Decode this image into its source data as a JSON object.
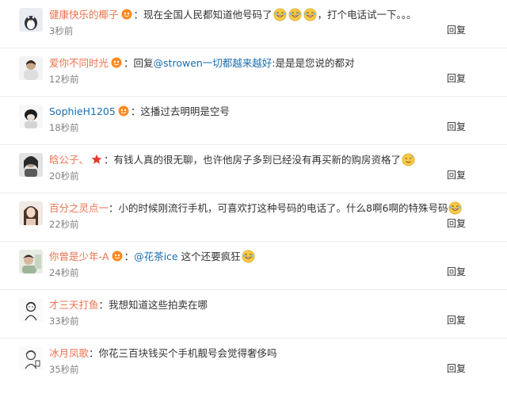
{
  "comments": [
    {
      "username": "健康快乐的椰子",
      "colon": "：",
      "text_before": "现在全国人民都知道他号码了",
      "emoji_count": 3,
      "text_after": "，打个电话试一下。。。",
      "time": "3秒前",
      "reply": "回复"
    },
    {
      "username": "爱你不同时光",
      "colon": "：",
      "reply_prefix": "回复",
      "mention": "@strowen一切都越来越好",
      "text_after": ":是是是您说的都对",
      "time": "12秒前",
      "reply": "回复"
    },
    {
      "username": "SophieH1205",
      "colon": "：",
      "text": "这播过去明明是空号",
      "time": "18秒前",
      "reply": "回复"
    },
    {
      "username": "晗公子、",
      "colon": "：",
      "text": "有钱人真的很无聊，也许他房子多到已经没有再买新的购房资格了",
      "time": "20秒前",
      "reply": "回复"
    },
    {
      "username": "百分之灵点一",
      "colon": "：",
      "text": "小的时候刚流行手机，可喜欢打这种号码的电话了。什么8啊6啊的特殊号码",
      "time": "22秒前",
      "reply": "回复"
    },
    {
      "username": "你曾是少年-A",
      "colon": "：",
      "mention": "@花茶ice",
      "text": "这个还要疯狂",
      "time": "24秒前",
      "reply": "回复"
    },
    {
      "username": "才三天打鱼",
      "colon": "：",
      "text": "我想知道这些拍卖在哪",
      "time": "33秒前",
      "reply": "回复"
    },
    {
      "username": "冰月凤歌",
      "colon": "：",
      "text": "你花三百块钱买个手机靓号会觉得奢侈吗",
      "time": "35秒前",
      "reply": "回复"
    }
  ],
  "colors": {
    "username": "#eb7350",
    "link": "#1a6fb0",
    "text": "#333333",
    "time": "#808080",
    "divider": "#ececec"
  },
  "icons": {
    "vip_badge": "vip-badge-icon",
    "laugh_emoji": "laugh-emoji-icon",
    "star_badge": "star-badge-icon"
  }
}
